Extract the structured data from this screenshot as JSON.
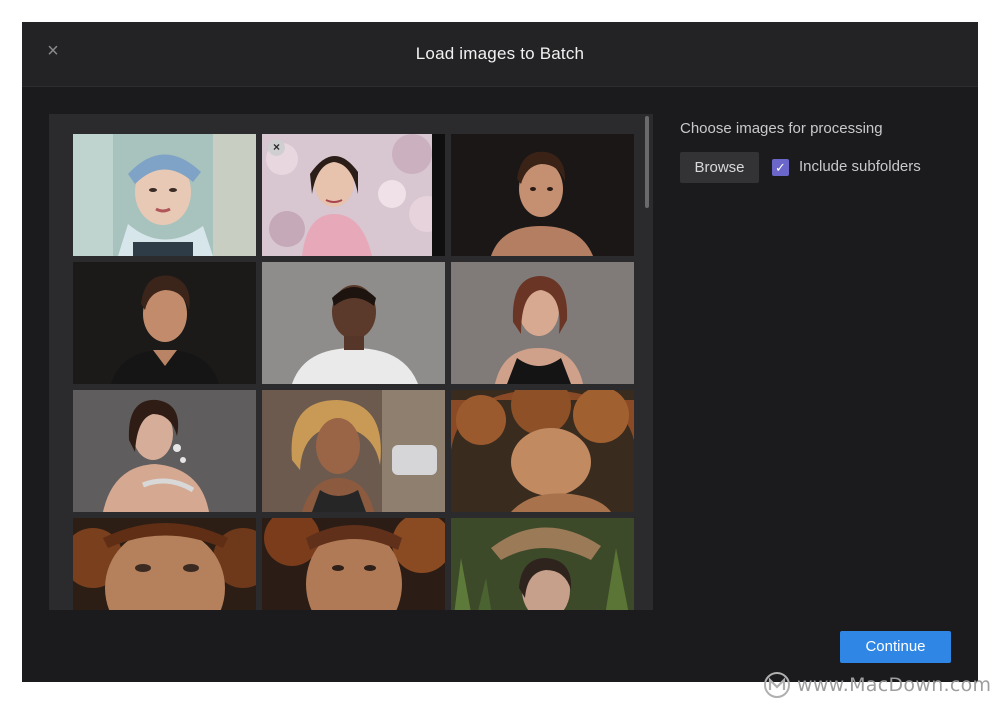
{
  "dialog": {
    "title": "Load images to Batch",
    "close_label": "×"
  },
  "thumbnails": [
    {
      "description": "woman with blue headscarf",
      "removable": false
    },
    {
      "description": "woman in front of cherry blossoms",
      "removable": true,
      "remove_label": "×"
    },
    {
      "description": "man on dark background",
      "removable": false
    },
    {
      "description": "man in dark t-shirt",
      "removable": false
    },
    {
      "description": "man in white t-shirt",
      "removable": false
    },
    {
      "description": "woman in black top",
      "removable": false
    },
    {
      "description": "woman with earrings",
      "removable": false
    },
    {
      "description": "woman with curly hair on street",
      "removable": false
    },
    {
      "description": "person with curly red hair",
      "removable": false
    },
    {
      "description": "freckled red-haired person close-up",
      "removable": false
    },
    {
      "description": "freckled person looking at camera",
      "removable": false
    },
    {
      "description": "woman with hat in corn field",
      "removable": false
    }
  ],
  "sidebar": {
    "label": "Choose images for processing",
    "browse_label": "Browse",
    "include_subfolders_label": "Include subfolders",
    "include_subfolders_checked": true,
    "check_mark": "✓"
  },
  "footer": {
    "continue_label": "Continue"
  },
  "watermark": {
    "text": "www.MacDown.com"
  },
  "colors": {
    "accent": "#2f86e4",
    "checkbox": "#6b66c9",
    "dialog_bg": "#1b1b1d"
  }
}
